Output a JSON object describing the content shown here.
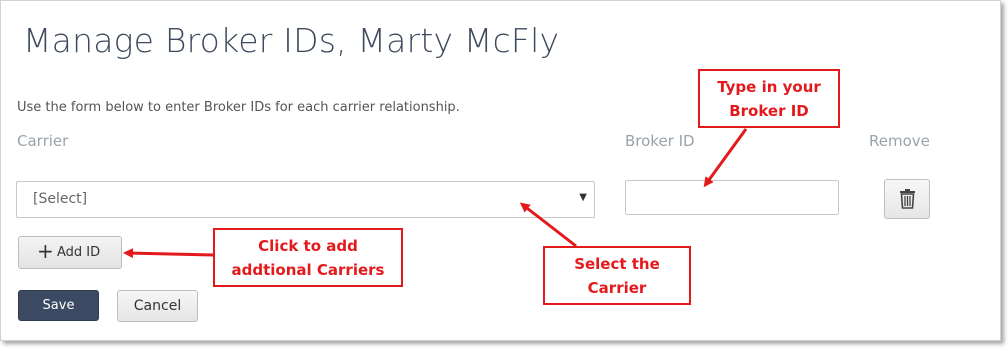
{
  "page": {
    "title": "Manage Broker IDs, Marty McFly",
    "intro": "Use the form below to enter Broker IDs for each carrier relationship."
  },
  "columns": {
    "carrier": "Carrier",
    "broker_id": "Broker ID",
    "remove": "Remove"
  },
  "row": {
    "carrier_value": "[Select]",
    "broker_id_value": ""
  },
  "buttons": {
    "add_id": "Add ID",
    "save": "Save",
    "cancel": "Cancel"
  },
  "annotations": {
    "type_broker": [
      "Type in your",
      "Broker ID"
    ],
    "add_carriers": [
      "Click to add",
      "addtional Carriers"
    ],
    "select_carrier": [
      "Select the",
      "Carrier"
    ]
  },
  "colors": {
    "annotation": "#e4191c",
    "primary_button": "#3b4a62",
    "title": "#3d4b5e"
  },
  "icons": {
    "remove": "trash-icon",
    "add": "plus-icon",
    "dropdown": "caret-down-icon"
  }
}
